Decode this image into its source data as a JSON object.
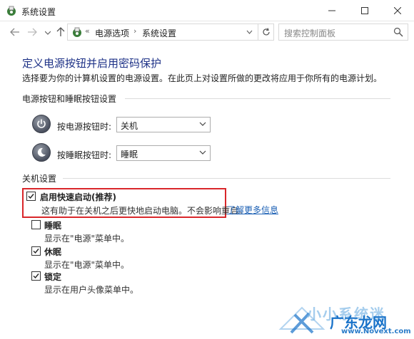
{
  "window": {
    "title": "系统设置"
  },
  "addressbar": {
    "breadcrumb": [
      "电源选项",
      "系统设置"
    ],
    "search_placeholder": "搜索控制面板"
  },
  "page": {
    "title": "定义电源按钮并启用密码保护",
    "description": "选择要为你的计算机设置的电源设置。在此页上对设置所做的更改将应用于你所有的电源计划。"
  },
  "power_buttons": {
    "heading": "电源按钮和睡眠按钮设置",
    "rows": [
      {
        "label": "按电源按钮时:",
        "value": "关机"
      },
      {
        "label": "按睡眠按钮时:",
        "value": "睡眠"
      }
    ]
  },
  "shutdown": {
    "heading": "关机设置",
    "options": [
      {
        "label": "启用快速启动(推荐)",
        "desc": "这有助于在关机之后更快地启动电脑。不会影响重启。",
        "checked": true
      },
      {
        "label": "睡眠",
        "desc": "显示在\"电源\"菜单中。",
        "checked": false
      },
      {
        "label": "休眠",
        "desc": "显示在\"电源\"菜单中。",
        "checked": true
      },
      {
        "label": "锁定",
        "desc": "显示在用户头像菜单中。",
        "checked": true
      }
    ],
    "learn_more": "了解更多信息"
  },
  "watermark": {
    "line1": "小小系统迷",
    "line2": "广东龙网",
    "url": "www.Novext.com"
  },
  "colors": {
    "title_blue": "#1e3287",
    "link_blue": "#1a5fb4",
    "highlight_red": "#d9262a"
  }
}
